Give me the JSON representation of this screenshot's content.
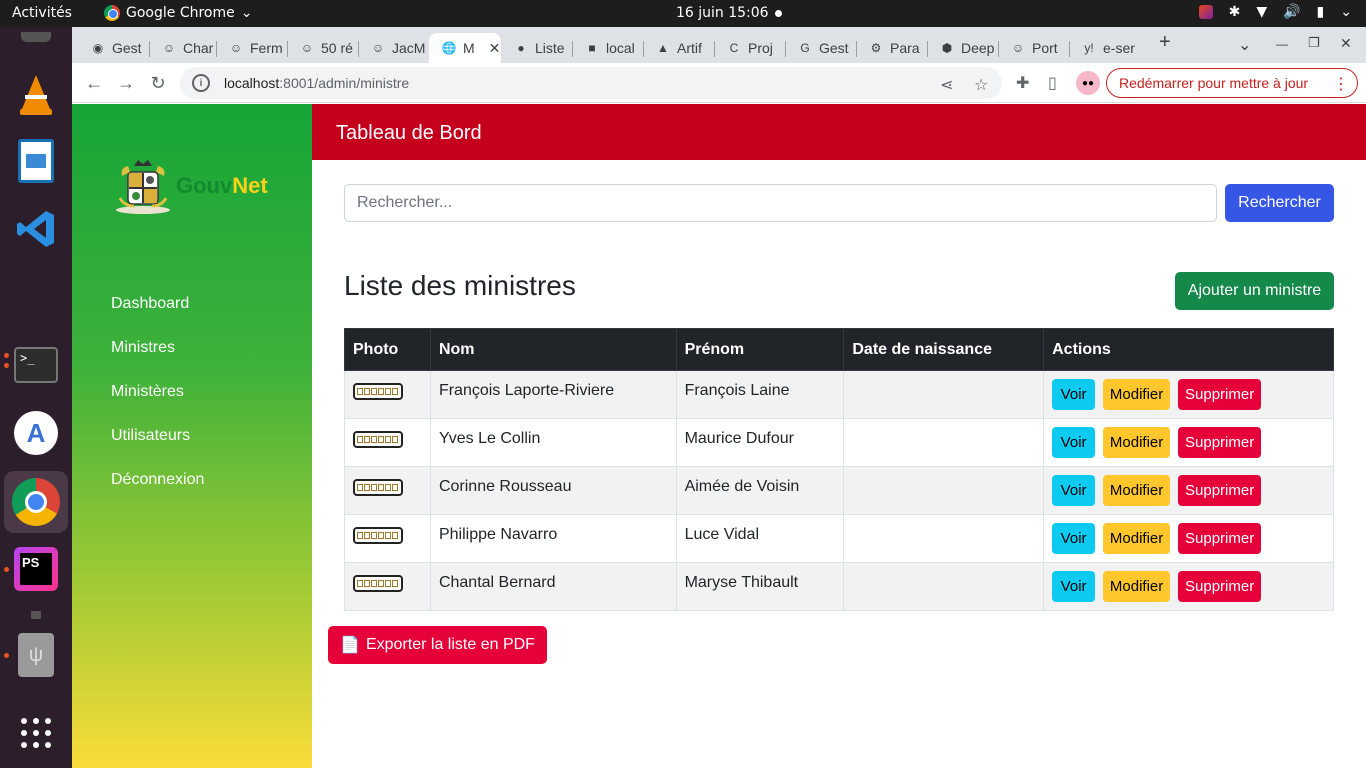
{
  "topbar": {
    "activities": "Activités",
    "app_name": "Google Chrome",
    "app_menu_arrow": "⌄",
    "clock": "16 juin  15:06"
  },
  "browser": {
    "tabs": [
      {
        "label": "Gest",
        "icon": "github-icon",
        "glyph": "◉"
      },
      {
        "label": "Char",
        "icon": "smiley-icon",
        "glyph": "☺"
      },
      {
        "label": "Ferm",
        "icon": "smiley-icon",
        "glyph": "☺"
      },
      {
        "label": "50 ré",
        "icon": "smiley-icon",
        "glyph": "☺"
      },
      {
        "label": "JacM",
        "icon": "smiley-icon",
        "glyph": "☺"
      },
      {
        "label": "M",
        "icon": "globe-icon",
        "glyph": "🌐",
        "active": true
      },
      {
        "label": "Liste",
        "icon": "circle-icon",
        "glyph": "●"
      },
      {
        "label": "local",
        "icon": "square-icon",
        "glyph": "■"
      },
      {
        "label": "Artif",
        "icon": "image-icon",
        "glyph": "▲"
      },
      {
        "label": "Proj",
        "icon": "canva-icon",
        "glyph": "C"
      },
      {
        "label": "Gest",
        "icon": "google-icon",
        "glyph": "G"
      },
      {
        "label": "Para",
        "icon": "gear-icon",
        "glyph": "⚙"
      },
      {
        "label": "Deep",
        "icon": "hexagon-icon",
        "glyph": "⬢"
      },
      {
        "label": "Port",
        "icon": "smiley-icon",
        "glyph": "☺"
      },
      {
        "label": "e-ser",
        "icon": "yahoo-icon",
        "glyph": "y!"
      }
    ],
    "close_glyph": "✕",
    "new_tab_glyph": "+",
    "tab_search_glyph": "⌄",
    "min_glyph": "—",
    "max_glyph": "❐",
    "win_close_glyph": "✕",
    "back_glyph": "←",
    "forward_glyph": "→",
    "reload_glyph": "↻",
    "url_host": "localhost",
    "url_rest": ":8001/admin/ministre",
    "info_glyph": "i",
    "share_glyph": "⋖",
    "star_glyph": "☆",
    "extensions_glyph": "✚",
    "sidepanel_glyph": "▯",
    "update_button": "Redémarrer pour mettre à jour",
    "more_glyph": "⋮"
  },
  "sidebar": {
    "logo_part1": "Gouv",
    "logo_part2": "Net",
    "items": [
      {
        "label": "Dashboard"
      },
      {
        "label": "Ministres"
      },
      {
        "label": "Ministères"
      },
      {
        "label": "Utilisateurs"
      },
      {
        "label": "Déconnexion"
      }
    ]
  },
  "header": {
    "title": "Tableau de Bord"
  },
  "search": {
    "placeholder": "Rechercher...",
    "value": "",
    "button": "Rechercher"
  },
  "main": {
    "title": "Liste des ministres",
    "add_button": "Ajouter un ministre",
    "columns": [
      "Photo",
      "Nom",
      "Prénom",
      "Date de naissance",
      "Actions"
    ],
    "rows": [
      {
        "nom": "François Laporte-Riviere",
        "prenom": "François Laine",
        "date": ""
      },
      {
        "nom": "Yves Le Collin",
        "prenom": "Maurice Dufour",
        "date": ""
      },
      {
        "nom": "Corinne Rousseau",
        "prenom": "Aimée de Voisin",
        "date": ""
      },
      {
        "nom": "Philippe Navarro",
        "prenom": "Luce Vidal",
        "date": ""
      },
      {
        "nom": "Chantal Bernard",
        "prenom": "Maryse Thibault",
        "date": ""
      }
    ],
    "action_labels": {
      "view": "Voir",
      "edit": "Modifier",
      "delete": "Supprimer"
    },
    "export_icon": "📄",
    "export_button": "Exporter la liste en PDF"
  },
  "colors": {
    "header_red": "#c4001d",
    "sidebar_green": "#16a538",
    "sidebar_yellow": "#fbdc3a",
    "primary_blue": "#3656e6",
    "success_green": "#15894a",
    "danger_red": "#e6003a",
    "info_cyan": "#0dcaf0",
    "warning_yellow": "#ffc72c"
  }
}
